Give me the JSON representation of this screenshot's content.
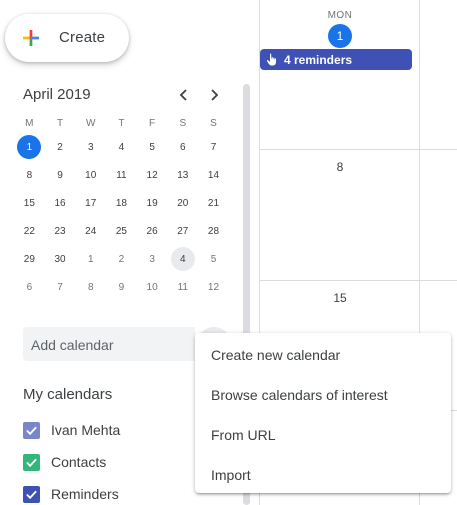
{
  "create": {
    "label": "Create"
  },
  "mini_calendar": {
    "title": "April 2019",
    "prev_icon": "chevron-left-icon",
    "next_icon": "chevron-right-icon",
    "weekdays": [
      "M",
      "T",
      "W",
      "T",
      "F",
      "S",
      "S"
    ],
    "weeks": [
      [
        {
          "d": "1",
          "state": "today"
        },
        {
          "d": "2"
        },
        {
          "d": "3"
        },
        {
          "d": "4"
        },
        {
          "d": "5"
        },
        {
          "d": "6"
        },
        {
          "d": "7"
        }
      ],
      [
        {
          "d": "8"
        },
        {
          "d": "9"
        },
        {
          "d": "10"
        },
        {
          "d": "11"
        },
        {
          "d": "12"
        },
        {
          "d": "13"
        },
        {
          "d": "14"
        }
      ],
      [
        {
          "d": "15"
        },
        {
          "d": "16"
        },
        {
          "d": "17"
        },
        {
          "d": "18"
        },
        {
          "d": "19"
        },
        {
          "d": "20"
        },
        {
          "d": "21"
        }
      ],
      [
        {
          "d": "22"
        },
        {
          "d": "23"
        },
        {
          "d": "24"
        },
        {
          "d": "25"
        },
        {
          "d": "26"
        },
        {
          "d": "27"
        },
        {
          "d": "28"
        }
      ],
      [
        {
          "d": "29"
        },
        {
          "d": "30"
        },
        {
          "d": "1",
          "state": "muted"
        },
        {
          "d": "2",
          "state": "muted"
        },
        {
          "d": "3",
          "state": "muted"
        },
        {
          "d": "4",
          "state": "selected"
        },
        {
          "d": "5",
          "state": "muted"
        }
      ],
      [
        {
          "d": "6",
          "state": "muted"
        },
        {
          "d": "7",
          "state": "muted"
        },
        {
          "d": "8",
          "state": "muted"
        },
        {
          "d": "9",
          "state": "muted"
        },
        {
          "d": "10",
          "state": "muted"
        },
        {
          "d": "11",
          "state": "muted"
        },
        {
          "d": "12",
          "state": "muted"
        }
      ]
    ]
  },
  "add_calendar": {
    "placeholder": "Add calendar"
  },
  "my_calendars": {
    "title": "My calendars",
    "items": [
      {
        "label": "Ivan Mehta",
        "color": "#7986cb"
      },
      {
        "label": "Contacts",
        "color": "#33b679"
      },
      {
        "label": "Reminders",
        "color": "#3f51b5"
      }
    ]
  },
  "main": {
    "day_of_week": "MON",
    "today_date": "1",
    "dates": [
      "8",
      "15"
    ],
    "reminders_chip": {
      "label": "4 reminders",
      "icon": "hand-pointer-icon",
      "color": "#3f51b5"
    }
  },
  "menu": {
    "items": [
      "Create new calendar",
      "Browse calendars of interest",
      "From URL",
      "Import"
    ]
  },
  "colors": {
    "accent": "#1a73e8"
  }
}
